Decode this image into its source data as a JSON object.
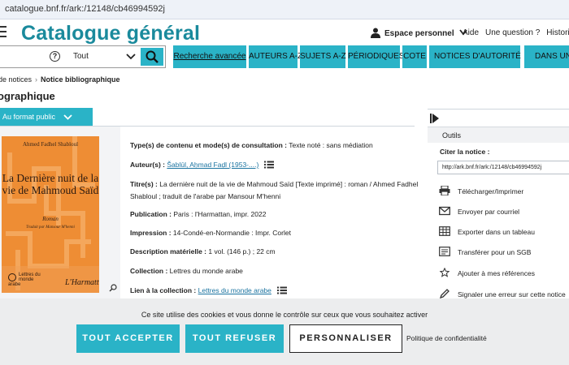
{
  "browser": {
    "url": "catalogue.bnf.fr/ark:/12148/cb46994592j"
  },
  "header": {
    "logo": "Catalogue général",
    "account": "Espace personnel",
    "links": [
      "Aide",
      "Une question ?",
      "Historique"
    ]
  },
  "search": {
    "scope_value": "Tout",
    "help_glyph": "?"
  },
  "nav": {
    "items": [
      "Recherche avancée",
      "AUTEURS A-Z",
      "SUJETS A-Z",
      "PÉRIODIQUES",
      "COTE",
      "NOTICES D'AUTORITÉ",
      "DANS UNIV"
    ],
    "help_glyph": "?"
  },
  "breadcrumb": {
    "prev": "de notices",
    "current": "Notice bibliographique"
  },
  "section_title": "ographique",
  "format_tab": "Au format public",
  "book": {
    "cover_author": "Ahmed Fadhel Shabloul",
    "cover_title": "La Dernière nuit de la vie de Mahmoud Saïd",
    "cover_genre": "Roman",
    "cover_translator": "Traduit par Mansour M'henni",
    "cover_collection": "Lettres du monde arabe",
    "cover_publisher": "L'Harmattan"
  },
  "record": {
    "type_label": "Type(s) de contenu et mode(s) de consultation :",
    "type_value": "Texte noté : sans médiation",
    "author_label": "Auteur(s) :",
    "author_value": "Šablūl, Aḥmad Faḍl (1953-....)",
    "title_label": "Titre(s) :",
    "title_line1": "La dernière nuit de la vie de Mahmoud Saïd [Texte imprimé] : roman / Ahmed Fadhel",
    "title_line2": "Shabloul ; traduit de l'arabe par Mansour M'henni",
    "pub_label": "Publication :",
    "pub_value": "Paris : l'Harmattan, impr. 2022",
    "print_label": "Impression :",
    "print_value": "14-Condé-en-Normandie : Impr. Corlet",
    "desc_label": "Description matérielle :",
    "desc_value": "1 vol. (146 p.) ; 22 cm",
    "coll_label": "Collection :",
    "coll_value": "Lettres du monde arabe",
    "link_label": "Lien à la collection :",
    "link_value": "Lettres du monde arabe"
  },
  "tools": {
    "heading": "Outils",
    "cite_label": "Citer la notice :",
    "ark": "http://ark.bnf.fr/ark:/12148/cb46994592j",
    "items": [
      {
        "label": "Télécharger/Imprimer",
        "icon": "printer-icon"
      },
      {
        "label": "Envoyer par courriel",
        "icon": "envelope-icon"
      },
      {
        "label": "Exporter dans un tableau",
        "icon": "table-icon"
      },
      {
        "label": "Transférer pour un SGB",
        "icon": "transfer-icon"
      },
      {
        "label": "Ajouter à mes références",
        "icon": "star-icon"
      },
      {
        "label": "Signaler une erreur sur cette notice",
        "icon": "pencil-icon"
      }
    ]
  },
  "cookie": {
    "message": "Ce site utilise des cookies et vous donne le contrôle sur ceux que vous souhaitez activer",
    "accept": "TOUT ACCEPTER",
    "refuse": "TOUT REFUSER",
    "customize": "PERSONNALISER",
    "privacy": "Politique de confidentialité"
  },
  "colors": {
    "brand": "#1a8a9c",
    "accent": "#2ab3c7",
    "cover": "#ee8d34"
  }
}
